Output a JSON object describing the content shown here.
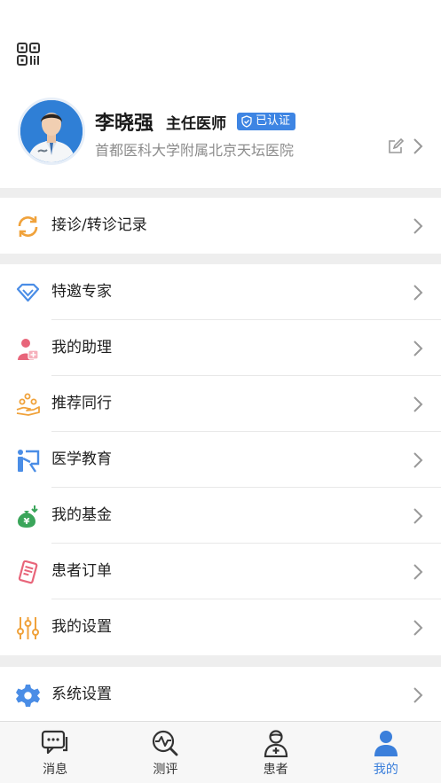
{
  "profile": {
    "name": "李晓强",
    "title": "主任医师",
    "verified_badge": "已认证",
    "hospital": "首都医科大学附属北京天坛医院"
  },
  "menu_groups": [
    [
      {
        "label": "接诊/转诊记录",
        "icon": "refresh-icon"
      }
    ],
    [
      {
        "label": "特邀专家",
        "icon": "diamond-icon"
      },
      {
        "label": "我的助理",
        "icon": "assistant-icon"
      },
      {
        "label": "推荐同行",
        "icon": "recommend-icon"
      },
      {
        "label": "医学教育",
        "icon": "education-icon"
      },
      {
        "label": "我的基金",
        "icon": "fund-icon"
      },
      {
        "label": "患者订单",
        "icon": "order-icon"
      },
      {
        "label": "我的设置",
        "icon": "sliders-icon"
      }
    ],
    [
      {
        "label": "系统设置",
        "icon": "gear-icon"
      }
    ]
  ],
  "tabbar": {
    "items": [
      {
        "label": "消息",
        "icon": "message-icon"
      },
      {
        "label": "测评",
        "icon": "evaluation-icon"
      },
      {
        "label": "患者",
        "icon": "patient-icon"
      },
      {
        "label": "我的",
        "icon": "user-icon"
      }
    ],
    "active_index": 3
  },
  "colors": {
    "accent": "#3b7fdb",
    "badge": "#3e85e3",
    "separator_band": "#eeeeee"
  }
}
